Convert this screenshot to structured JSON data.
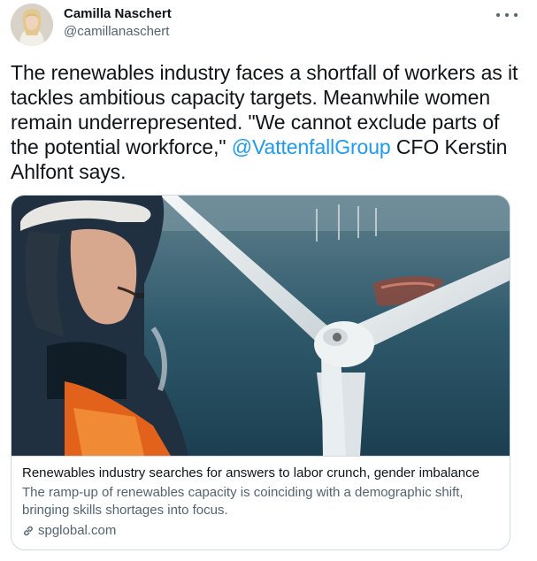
{
  "author": {
    "display_name": "Camilla Naschert",
    "handle": "@camillanaschert"
  },
  "more_icon": "more-horizontal-icon",
  "tweet": {
    "text_before": "The renewables industry faces a shortfall of workers as it tackles ambitious capacity targets. Meanwhile women remain underrepresented. \"We cannot exclude parts of the potential workforce,\" ",
    "mention": "@VattenfallGroup",
    "text_after": " CFO Kerstin Ahlfont says."
  },
  "card": {
    "title": "Renewables industry searches for answers to labor crunch, gender imbalance",
    "description": "The ramp-up of renewables capacity is coinciding with a demographic shift, bringing skills shortages into focus.",
    "domain": "spglobal.com",
    "domain_icon": "link-icon"
  },
  "colors": {
    "text": "#0f1419",
    "secondary": "#536471",
    "link": "#1d9bf0",
    "border": "#cfd9de"
  }
}
